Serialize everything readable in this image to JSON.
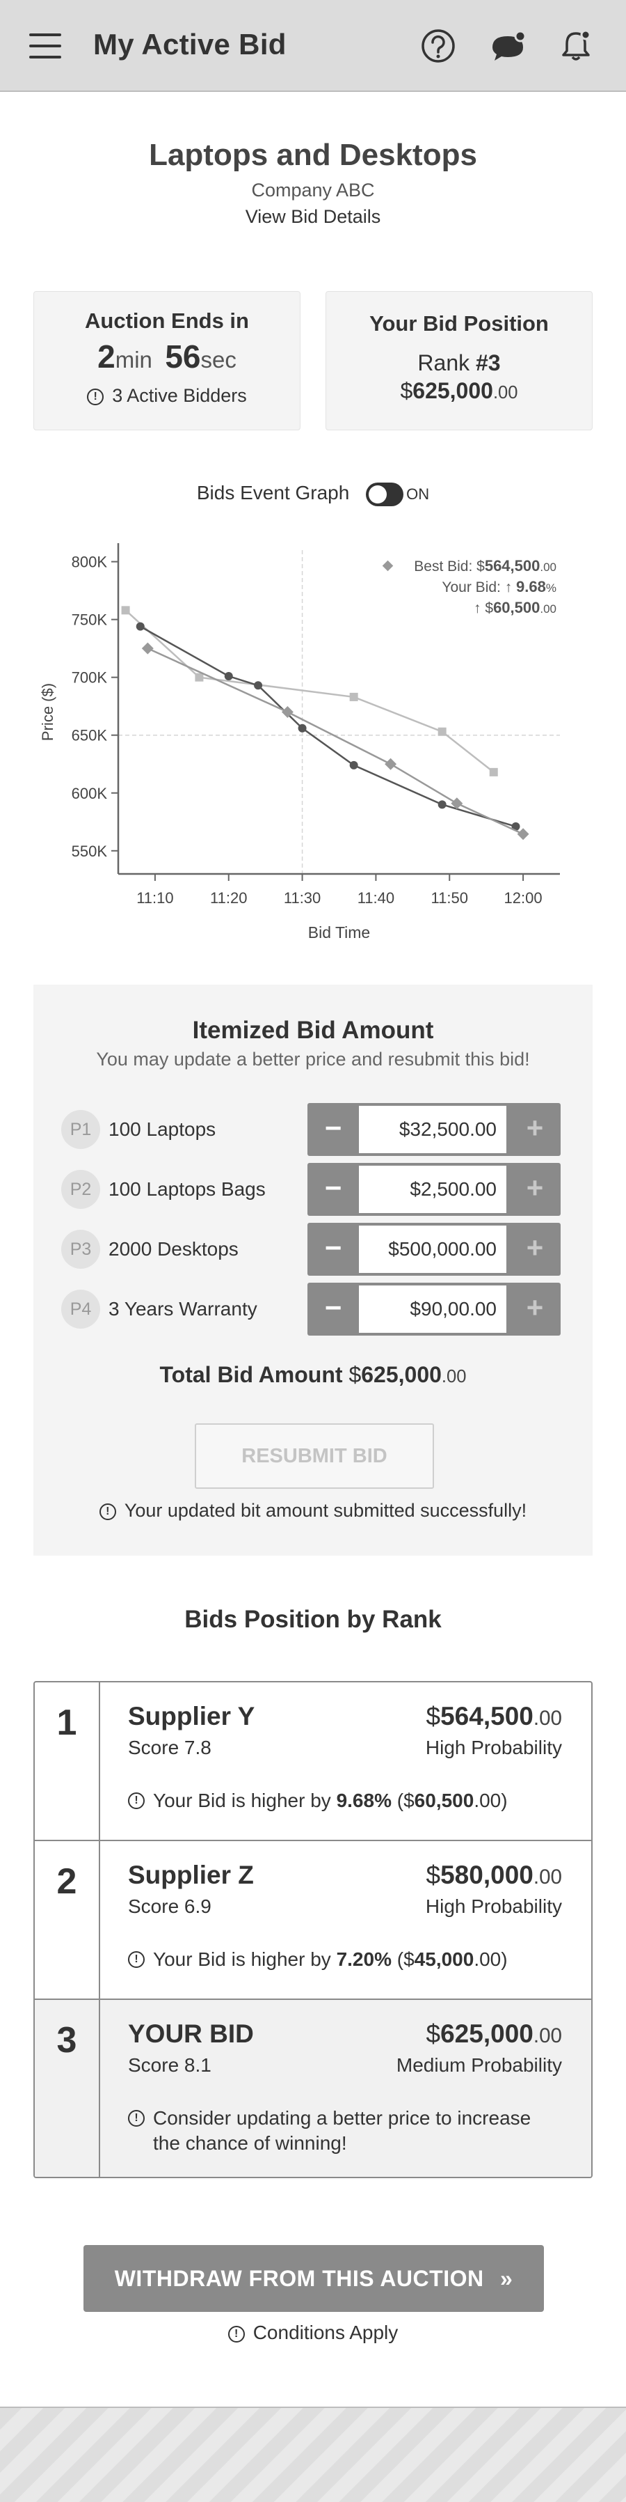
{
  "header": {
    "title": "My Active Bid"
  },
  "listing": {
    "title": "Laptops and Desktops",
    "company": "Company ABC",
    "details_link": "View Bid Details"
  },
  "auction": {
    "label": "Auction Ends in",
    "minutes": "2",
    "min_unit": "min",
    "seconds": "56",
    "sec_unit": "sec",
    "bidders": "3 Active Bidders"
  },
  "position": {
    "label": "Your Bid Position",
    "rank_prefix": "Rank ",
    "rank_value": "#3",
    "amount_currency": "$",
    "amount_main": "625,000",
    "amount_cents": ".00"
  },
  "graph": {
    "toggle_label": "Bids Event Graph",
    "toggle_state": "ON"
  },
  "chart_data": {
    "type": "line",
    "xlabel": "Bid Time",
    "ylabel": "Price ($)",
    "x_ticks": [
      "11:10",
      "11:20",
      "11:30",
      "11:40",
      "11:50",
      "12:00"
    ],
    "xlim": [
      "11:05",
      "12:05"
    ],
    "y_ticks": [
      "800K",
      "750K",
      "700K",
      "650K",
      "600K",
      "550K"
    ],
    "ylim": [
      530000,
      810000
    ],
    "legend": {
      "best_prefix": "Best Bid: $",
      "best_main": "564,500",
      "best_cents": ".00",
      "your_prefix": "Your Bid:  ↑ ",
      "your_pct": "9.68",
      "your_pct_unit": "%",
      "diff_prefix": "↑ $",
      "diff_main": "60,500",
      "diff_cents": ".00"
    },
    "reference_lines": {
      "y": 650000,
      "x": "11:30"
    },
    "series": [
      {
        "color": "#bdbdbd",
        "marker": "square",
        "points": [
          [
            "11:06",
            758000
          ],
          [
            "11:16",
            700000
          ],
          [
            "11:37",
            683000
          ],
          [
            "11:49",
            653000
          ],
          [
            "11:56",
            618000
          ]
        ]
      },
      {
        "color": "#555555",
        "marker": "circle",
        "points": [
          [
            "11:08",
            744000
          ],
          [
            "11:20",
            701000
          ],
          [
            "11:24",
            693000
          ],
          [
            "11:30",
            656000
          ],
          [
            "11:37",
            624000
          ],
          [
            "11:49",
            590000
          ],
          [
            "11:59",
            571000
          ]
        ]
      },
      {
        "color": "#999999",
        "marker": "diamond",
        "points": [
          [
            "11:09",
            725000
          ],
          [
            "11:28",
            670000
          ],
          [
            "11:42",
            625000
          ],
          [
            "11:51",
            591000
          ],
          [
            "12:00",
            564500
          ]
        ]
      }
    ]
  },
  "itemized": {
    "title": "Itemized Bid Amount",
    "subtitle": "You may update a better price and resubmit this bid!",
    "items": [
      {
        "tag": "P1",
        "name": "100 Laptops",
        "value": "$32,500.00"
      },
      {
        "tag": "P2",
        "name": "100 Laptops Bags",
        "value": "$2,500.00"
      },
      {
        "tag": "P3",
        "name": "2000 Desktops",
        "value": "$500,000.00"
      },
      {
        "tag": "P4",
        "name": "3 Years Warranty",
        "value": "$90,00.00"
      }
    ],
    "minus": "−",
    "plus": "+",
    "total_label": "Total Bid Amount ",
    "total_currency": "$",
    "total_main": "625,000",
    "total_cents": ".00",
    "resubmit": "RESUBMIT BID",
    "success": "Your updated bit amount submitted successfully!"
  },
  "ranks": {
    "title": "Bids Position by Rank",
    "rows": [
      {
        "rank": "1",
        "supplier": "Supplier Y",
        "score": "Score 7.8",
        "currency": "$",
        "main": "564,500",
        "cents": ".00",
        "prob": "High Probability",
        "note_pre": "Your Bid is higher by ",
        "note_pct": "9.68%",
        "note_mid": " ($",
        "note_amt": "60,500",
        "note_post": ".00)"
      },
      {
        "rank": "2",
        "supplier": "Supplier Z",
        "score": "Score 6.9",
        "currency": "$",
        "main": "580,000",
        "cents": ".00",
        "prob": "High Probability",
        "note_pre": "Your Bid is higher by ",
        "note_pct": "7.20%",
        "note_mid": " ($",
        "note_amt": "45,000",
        "note_post": ".00)"
      },
      {
        "rank": "3",
        "supplier": "YOUR BID",
        "score": "Score 8.1",
        "currency": "$",
        "main": "625,000",
        "cents": ".00",
        "prob": "Medium Probability",
        "note": "Consider updating a better price to increase the chance of winning!"
      }
    ]
  },
  "withdraw": {
    "label": "WITHDRAW FROM THIS AUCTION",
    "arrow": "»"
  },
  "conditions": "Conditions Apply",
  "icons": {
    "excl": "!"
  }
}
